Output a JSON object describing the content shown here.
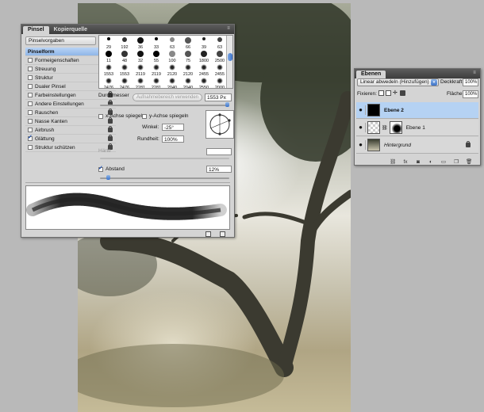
{
  "brush_panel": {
    "tabs": [
      "Pinsel",
      "Kopierquelle"
    ],
    "presets_button": "Pinselvorgaben",
    "options": [
      {
        "label": "Pinselform",
        "head": true
      },
      {
        "label": "Formeigenschaften",
        "checked": false,
        "lock": true
      },
      {
        "label": "Streuung",
        "checked": false,
        "lock": true
      },
      {
        "label": "Struktur",
        "checked": false,
        "lock": true
      },
      {
        "label": "Dualer Pinsel",
        "checked": false,
        "lock": true
      },
      {
        "label": "Farbeinstellungen",
        "checked": false,
        "lock": true
      },
      {
        "label": "Andere Einstellungen",
        "checked": false,
        "lock": true
      },
      {
        "label": "Rauschen",
        "checked": false,
        "lock": true
      },
      {
        "label": "Nasse Kanten",
        "checked": false,
        "lock": true
      },
      {
        "label": "Airbrush",
        "checked": false,
        "lock": true
      },
      {
        "label": "Glättung",
        "checked": true,
        "lock": true
      },
      {
        "label": "Struktur schützen",
        "checked": false,
        "lock": true
      }
    ],
    "tips": [
      [
        "29",
        "192",
        "36",
        "33",
        "63",
        "66",
        "39",
        "63"
      ],
      [
        "11",
        "48",
        "32",
        "55",
        "100",
        "75",
        "1800",
        "2500"
      ],
      [
        "1553",
        "1553",
        "2119",
        "2119",
        "2120",
        "2120",
        "2455",
        "2455"
      ],
      [
        "2476",
        "2476",
        "2281",
        "2281",
        "2040",
        "2040",
        "2550",
        "2000"
      ]
    ],
    "diameter_label": "Durchmesser",
    "sample_button": "Aufnahmebereich verwenden",
    "diameter_value": "1553 Px",
    "flip_x": "x-Achse spiegeln",
    "flip_y": "y-Achse spiegeln",
    "angle_label": "Winkel:",
    "angle_value": "-25°",
    "roundness_label": "Rundheit:",
    "roundness_value": "100%",
    "hardness_label": "Härte",
    "spacing_label": "Abstand",
    "spacing_checked": true,
    "spacing_value": "12%"
  },
  "layers_panel": {
    "tab": "Ebenen",
    "blend_mode": "Linear abwedeln (Hinzufügen)",
    "opacity_label": "Deckkraft:",
    "opacity_value": "100%",
    "lock_label": "Fixieren:",
    "fill_label": "Fläche:",
    "fill_value": "100%",
    "layers": [
      {
        "name": "Ebene 2",
        "selected": true
      },
      {
        "name": "Ebene 1",
        "selected": false
      },
      {
        "name": "Hintergrund",
        "selected": false
      }
    ],
    "footer_icons": [
      "link-icon",
      "fx-icon",
      "mask-icon",
      "adjustment-icon",
      "folder-icon",
      "new-layer-icon",
      "trash-icon"
    ]
  },
  "colors": {
    "selection": "#b5d2f3",
    "accent": "#3b72c8",
    "panel": "#d4d4d4"
  }
}
